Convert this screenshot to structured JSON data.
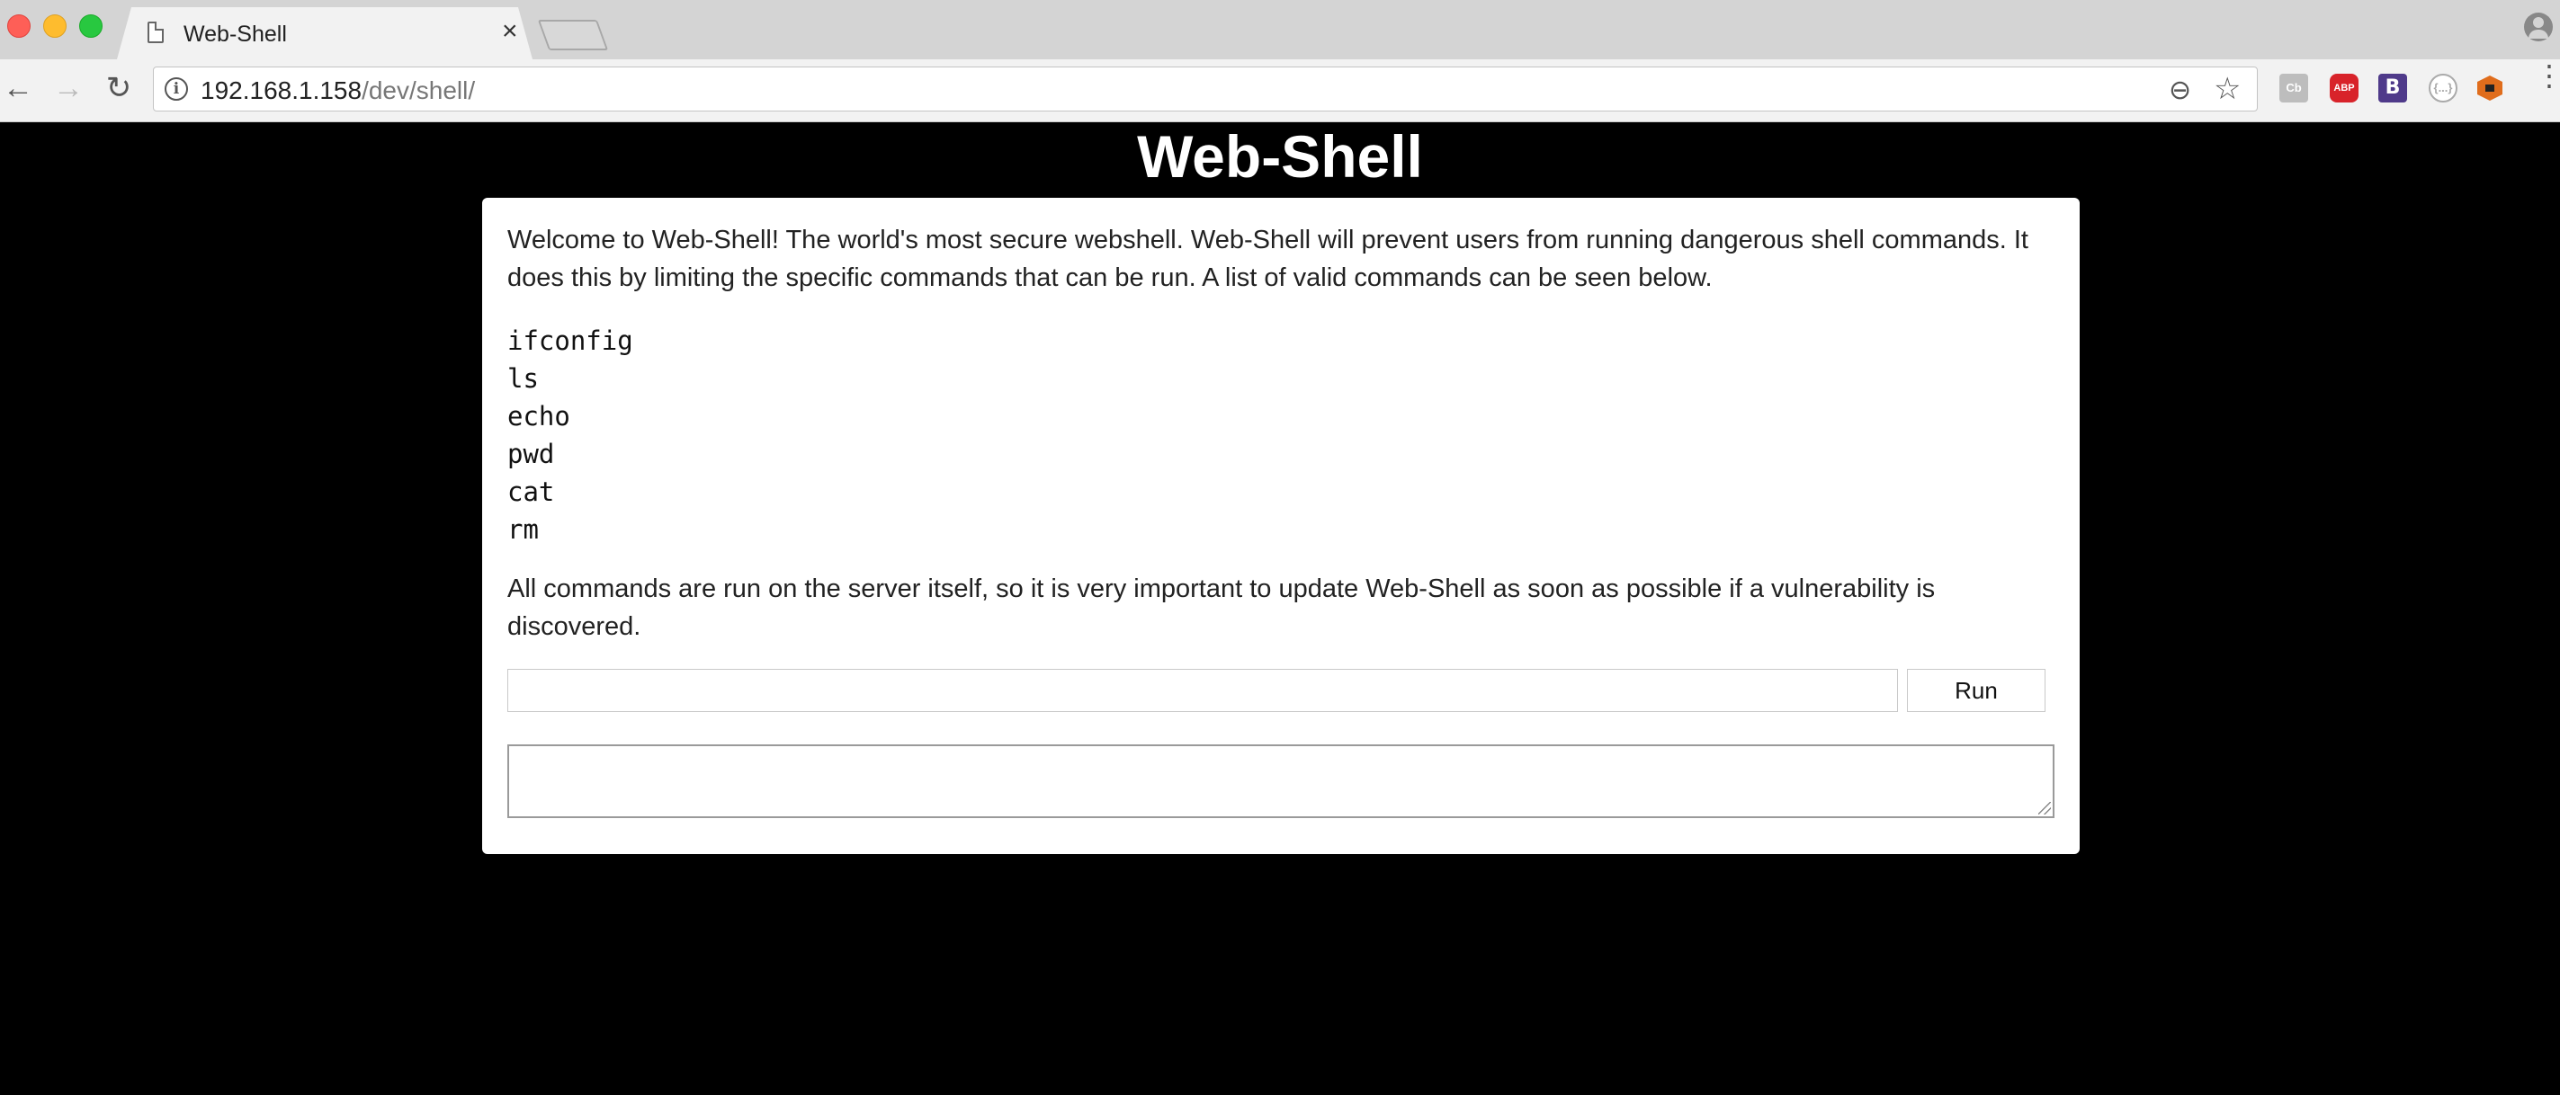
{
  "browser": {
    "tab": {
      "title": "Web-Shell",
      "close_symbol": "×"
    },
    "toolbar": {
      "back_icon": "←",
      "forward_icon": "→",
      "reload_icon": "↻",
      "url_host": "192.168.1.158",
      "url_path": "/dev/shell/",
      "info_icon": "i",
      "zoom_icon": "⊖",
      "star_icon": "☆"
    },
    "extensions": [
      {
        "name": "cb-extension-icon",
        "label": "Cb"
      },
      {
        "name": "adblock-plus-icon",
        "label": "ABP"
      },
      {
        "name": "b-extension-icon",
        "label": "B"
      },
      {
        "name": "json-viewer-icon",
        "label": "{...}"
      },
      {
        "name": "hex-extension-icon",
        "label": ""
      }
    ],
    "menu_icon": "⋮"
  },
  "page": {
    "title": "Web-Shell",
    "intro": "Welcome to Web-Shell! The world's most secure webshell. Web-Shell will prevent users from running dangerous shell commands. It does this by limiting the specific commands that can be run. A list of valid commands can be seen below.",
    "commands": [
      "ifconfig",
      "ls",
      "echo",
      "pwd",
      "cat",
      "rm"
    ],
    "outro": "All commands are run on the server itself, so it is very important to update Web-Shell as soon as possible if a vulnerability is discovered.",
    "command_input": {
      "value": "",
      "placeholder": ""
    },
    "run_button_label": "Run",
    "output": ""
  }
}
